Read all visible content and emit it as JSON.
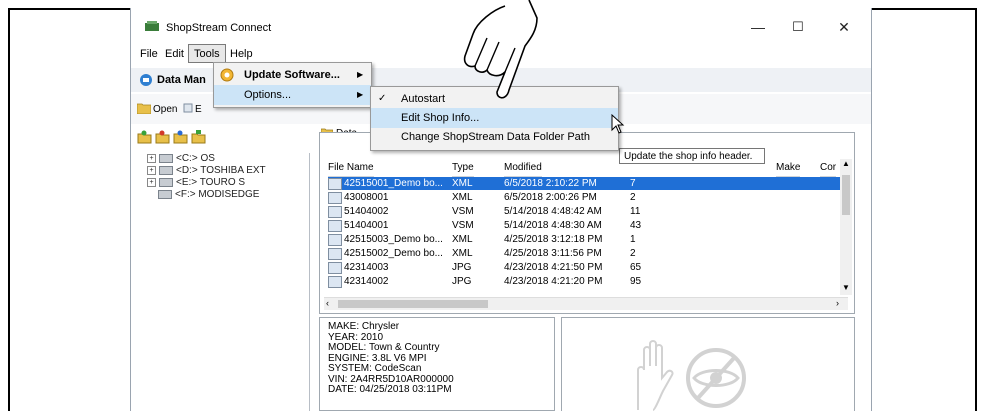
{
  "app": {
    "title": "ShopStream Connect",
    "minimize": "—",
    "maximize": "☐",
    "close": "✕"
  },
  "menubar": {
    "file": "File",
    "edit": "Edit",
    "tools": "Tools",
    "help": "Help"
  },
  "toolbar": {
    "data_manager": "Data Man",
    "open": "Open",
    "e": "E",
    "data_tab": "Data"
  },
  "tools_menu": {
    "update": "Update Software...",
    "options": "Options..."
  },
  "options_menu": {
    "autostart": "Autostart",
    "edit_shop_info": "Edit Shop Info...",
    "change_path": "Change ShopStream Data Folder Path"
  },
  "tooltip": "Update the shop info header.",
  "tree": [
    {
      "label": "<C:> OS"
    },
    {
      "label": "<D:> TOSHIBA EXT"
    },
    {
      "label": "<E:> TOURO S"
    },
    {
      "label": "<F:> MODISEDGE"
    }
  ],
  "columns": {
    "file_name": "File Name",
    "type": "Type",
    "modified": "Modified",
    "make": "Make",
    "cor": "Cor"
  },
  "files": [
    {
      "name": "42515001_Demo bo...",
      "type": "XML",
      "modified": "6/5/2018 2:10:22 PM",
      "size": "7"
    },
    {
      "name": "43008001",
      "type": "XML",
      "modified": "6/5/2018 2:00:26 PM",
      "size": "2"
    },
    {
      "name": "51404002",
      "type": "VSM",
      "modified": "5/14/2018 4:48:42 AM",
      "size": "11"
    },
    {
      "name": "51404001",
      "type": "VSM",
      "modified": "5/14/2018 4:48:30 AM",
      "size": "43"
    },
    {
      "name": "42515003_Demo bo...",
      "type": "XML",
      "modified": "4/25/2018 3:12:18 PM",
      "size": "1"
    },
    {
      "name": "42515002_Demo bo...",
      "type": "XML",
      "modified": "4/25/2018 3:11:56 PM",
      "size": "2"
    },
    {
      "name": "42314003",
      "type": "JPG",
      "modified": "4/23/2018 4:21:50 PM",
      "size": "65"
    },
    {
      "name": "42314002",
      "type": "JPG",
      "modified": "4/23/2018 4:21:20 PM",
      "size": "95"
    }
  ],
  "details": [
    "MAKE: Chrysler",
    "YEAR: 2010",
    "MODEL: Town & Country",
    "ENGINE: 3.8L V6 MPI",
    "SYSTEM: CodeScan",
    "VIN: 2A4RR5D10AR000000",
    "DATE: 04/25/2018  03:11PM"
  ],
  "colors": {
    "selection": "#1f6fd6",
    "menu_highlight": "#cce4f7"
  }
}
